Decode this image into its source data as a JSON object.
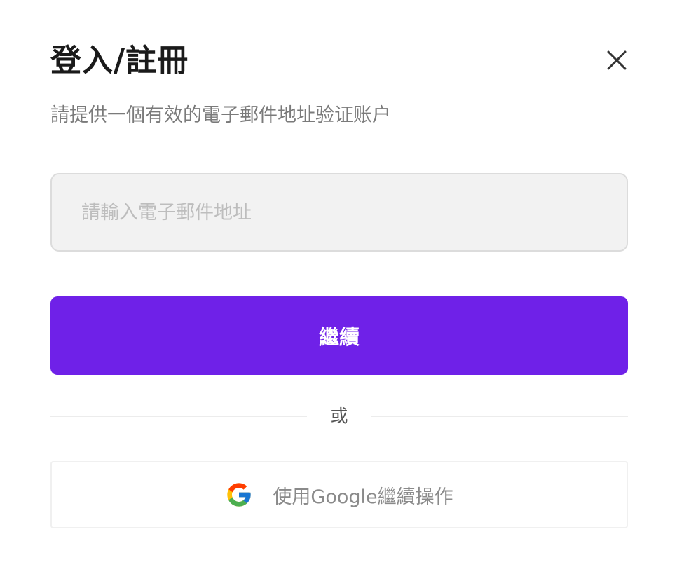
{
  "dialog": {
    "title": "登入/註冊",
    "subtitle": "請提供一個有效的電子郵件地址验证账户"
  },
  "email": {
    "placeholder": "請輸入電子郵件地址",
    "value": ""
  },
  "continue_button": {
    "label": "繼續",
    "color": "#6f21e8"
  },
  "divider": {
    "text": "或"
  },
  "google_button": {
    "label": "使用Google繼續操作",
    "icon": "google-icon"
  },
  "close_icon": "close-icon"
}
